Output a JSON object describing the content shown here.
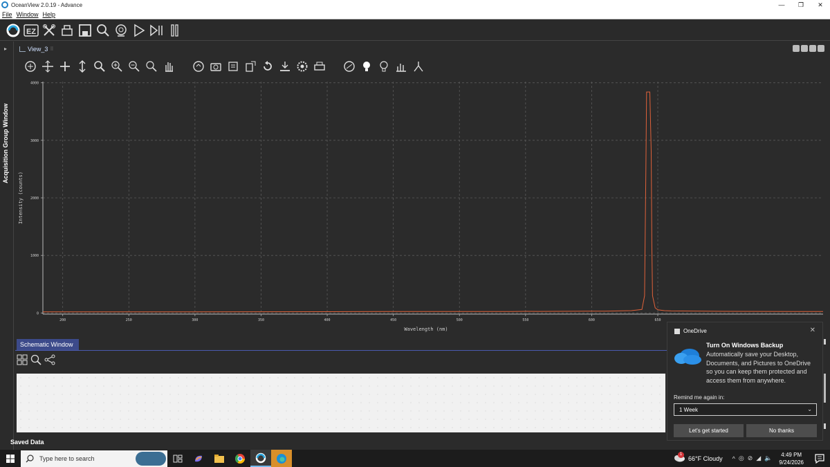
{
  "window": {
    "title": "OceanView 2.0.19 - Advance",
    "controls": {
      "minimize": "—",
      "restore": "❐",
      "close": "✕"
    }
  },
  "menu": {
    "items": [
      "File",
      "Window",
      "Help"
    ]
  },
  "main_toolbar": {
    "icons": [
      "oceanview-logo-icon",
      "ez-icon",
      "tools-icon",
      "print-share-icon",
      "save-icon",
      "search-icon",
      "settings-globe-icon",
      "play-icon",
      "step-icon",
      "pause-icon"
    ],
    "ez_label": "EZ"
  },
  "left_panel": {
    "label": "Acquisition Group Window"
  },
  "view": {
    "tab_label": "View_3",
    "tab_grip": "⠿"
  },
  "plot_toolbar": {
    "icons": [
      "autoscale-icon",
      "move-all-icon",
      "pan-icon",
      "vertical-scale-icon",
      "zoom-region-icon",
      "zoom-in-icon",
      "zoom-out-icon",
      "zoom-reset-icon",
      "hand-icon",
      "refresh-icon",
      "camera-icon",
      "clear-icon",
      "export-icon",
      "rotate-icon",
      "download-icon",
      "settings-icon",
      "print-icon",
      "overlay-icon",
      "bulb-on-icon",
      "bulb-off-icon",
      "peaks-icon",
      "marker-icon"
    ]
  },
  "chart_data": {
    "type": "line",
    "xlabel": "Wavelength (nm)",
    "ylabel": "Intensity (counts)",
    "xlim": [
      185,
      775
    ],
    "ylim": [
      -20,
      4020
    ],
    "x_ticks": [
      200,
      250,
      300,
      350,
      400,
      450,
      500,
      550,
      600,
      650
    ],
    "y_ticks": [
      0,
      1000,
      2000,
      3000,
      4000
    ],
    "grid": true,
    "series_color": "#e0623a",
    "series": [
      {
        "x": [
          185,
          300,
          400,
          450,
          500,
          540,
          550,
          560,
          600,
          610,
          620,
          630,
          638,
          640,
          641,
          641.5,
          642,
          643,
          644,
          645,
          645.5,
          646,
          648,
          650,
          655,
          660,
          700,
          775
        ],
        "y": [
          18,
          20,
          22,
          25,
          24,
          26,
          28,
          27,
          30,
          32,
          35,
          40,
          60,
          300,
          2500,
          3840,
          3840,
          3840,
          3840,
          2800,
          1200,
          300,
          90,
          55,
          40,
          35,
          28,
          25
        ]
      }
    ]
  },
  "schematic": {
    "tab_label": "Schematic Window",
    "tools": [
      "layout-icon",
      "search-icon",
      "connections-icon"
    ]
  },
  "saved_data": {
    "label": "Saved Data"
  },
  "toast": {
    "app": "OneDrive",
    "close": "✕",
    "title": "Turn On Windows Backup",
    "body": "Automatically save your Desktop, Documents, and Pictures to OneDrive so you can keep them protected and access them from anywhere.",
    "remind_label": "Remind me again in:",
    "remind_value": "1 Week",
    "primary_button": "Let's get started",
    "secondary_button": "No thanks"
  },
  "taskbar": {
    "search_placeholder": "Type here to search",
    "weather": "66°F  Cloudy",
    "time": "4:49 PM",
    "date": "9/24/2026",
    "tray_chevron": "^",
    "weather_badge": "1"
  }
}
